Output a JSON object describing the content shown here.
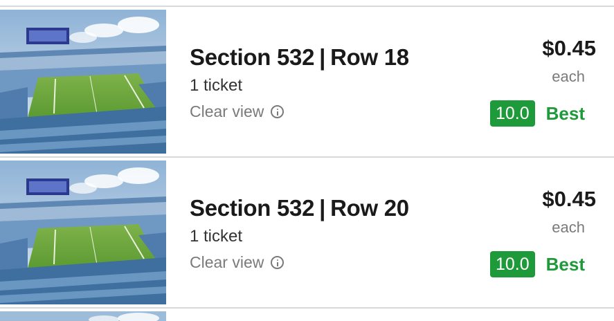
{
  "colors": {
    "deal_green": "#1f9a3a",
    "divider": "#d9d9d9",
    "muted_text": "#7a7a7a"
  },
  "listings": [
    {
      "section": "Section 532",
      "separator": "|",
      "row": "Row 18",
      "quantity": "1 ticket",
      "view": "Clear view",
      "view_icon": "info-icon",
      "price": "$0.45",
      "price_unit": "each",
      "deal_score": "10.0",
      "deal_label": "Best"
    },
    {
      "section": "Section 532",
      "separator": "|",
      "row": "Row 20",
      "quantity": "1 ticket",
      "view": "Clear view",
      "view_icon": "info-icon",
      "price": "$0.45",
      "price_unit": "each",
      "deal_score": "10.0",
      "deal_label": "Best"
    }
  ]
}
